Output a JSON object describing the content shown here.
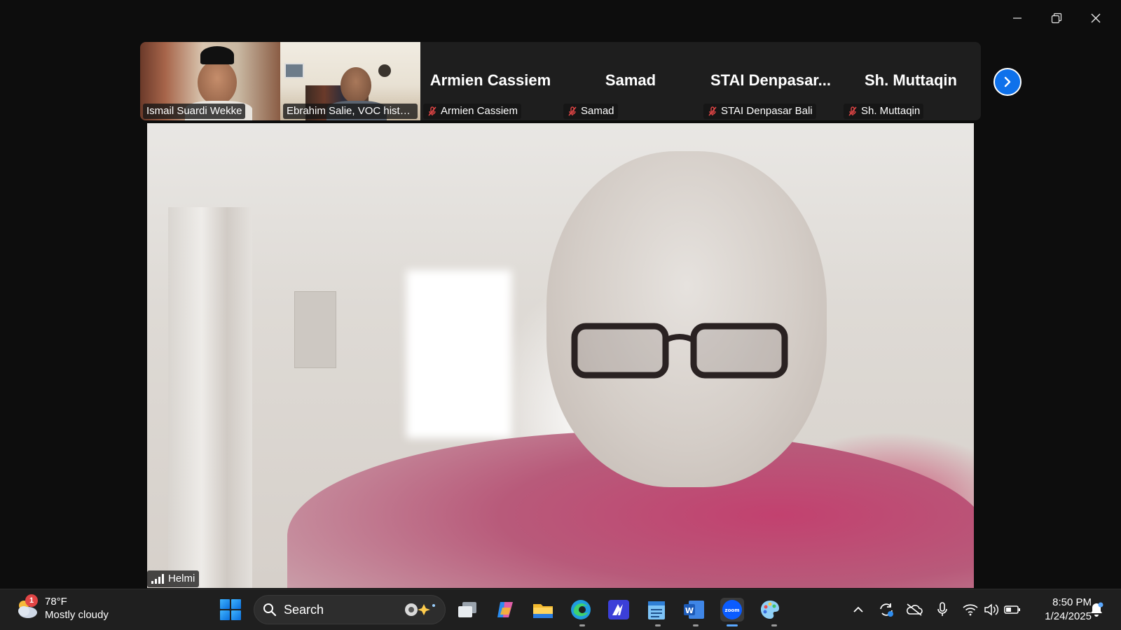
{
  "participants": [
    {
      "name": "Ismail Suardi Wekke",
      "type": "video"
    },
    {
      "name": "Ebrahim Salie, VOC histor...",
      "type": "video"
    },
    {
      "name": "Armien Cassiem",
      "display": "Armien Cassiem",
      "type": "audio",
      "muted": true
    },
    {
      "name": "Samad",
      "display": "Samad",
      "type": "audio",
      "muted": true
    },
    {
      "name": "STAI Denpasar Bali",
      "display": "STAI  Denpasar...",
      "type": "audio",
      "muted": true
    },
    {
      "name": "Sh. Muttaqin",
      "display": "Sh. Muttaqin",
      "type": "audio",
      "muted": true
    }
  ],
  "active_speaker": {
    "name": "Helmi"
  },
  "taskbar": {
    "weather": {
      "temp": "78°F",
      "condition": "Mostly cloudy",
      "badge": "1"
    },
    "search_label": "Search",
    "clock": {
      "time": "8:50 PM",
      "date": "1/24/2025"
    }
  },
  "colors": {
    "accent": "#0e71eb",
    "muted_mic": "#e14545",
    "taskbar": "#1f1f1f"
  }
}
